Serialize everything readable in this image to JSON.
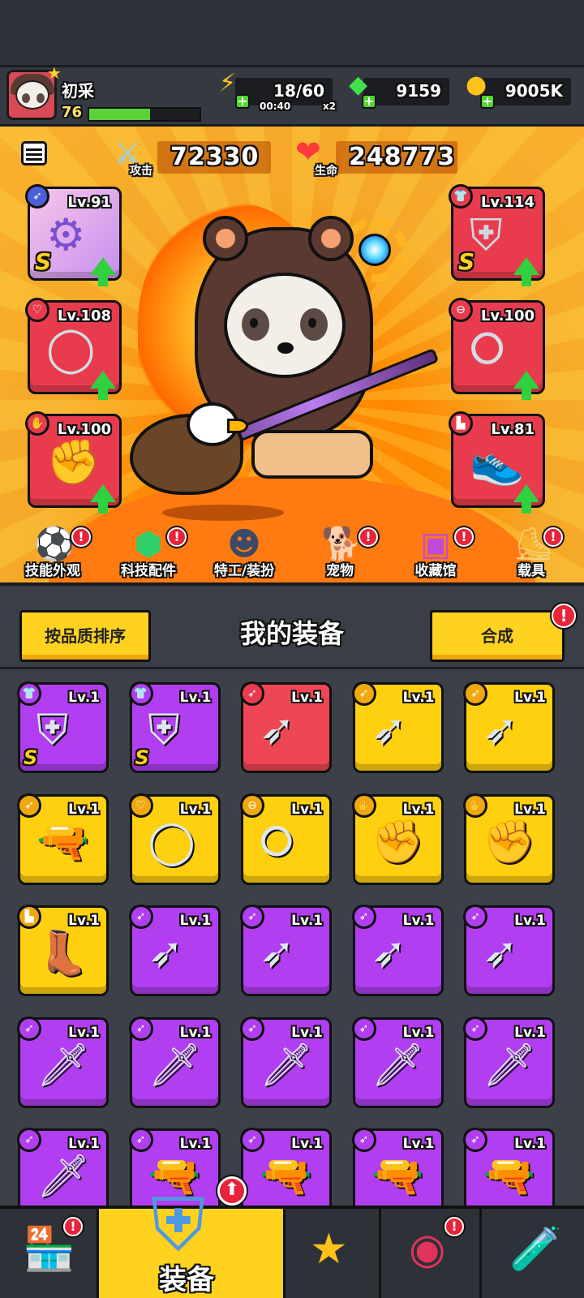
{
  "player": {
    "name": "初采",
    "level": "76",
    "xp_fraction": 0.55
  },
  "resources": {
    "energy": {
      "value": "18/60",
      "timer": "00:40",
      "multiplier": "x2",
      "icon": "energy-bolt-icon"
    },
    "gems": {
      "value": "9159",
      "icon": "green-gem-icon"
    },
    "coins": {
      "value": "9005K",
      "icon": "gold-coin-icon"
    }
  },
  "stats": {
    "attack": {
      "label": "攻击",
      "value": "72330"
    },
    "health": {
      "label": "生命",
      "value": "248773"
    }
  },
  "equipped": {
    "weapon": {
      "level": "Lv.91",
      "rarity": "S",
      "upgradable": true
    },
    "armor": {
      "level": "Lv.114",
      "rarity": "S",
      "upgradable": true
    },
    "necklace": {
      "level": "Lv.108",
      "upgradable": true
    },
    "belt": {
      "level": "Lv.100",
      "upgradable": true
    },
    "gloves": {
      "level": "Lv.100",
      "upgradable": true
    },
    "boots": {
      "level": "Lv.81",
      "upgradable": true
    }
  },
  "quick_nav": [
    {
      "label": "技能外观",
      "icon": "skill-skin-icon",
      "alert": "!"
    },
    {
      "label": "科技配件",
      "icon": "tech-part-icon",
      "alert": "!"
    },
    {
      "label": "特工/装扮",
      "icon": "agent-costume-icon",
      "alert": ""
    },
    {
      "label": "宠物",
      "icon": "pet-icon",
      "alert": "!"
    },
    {
      "label": "收藏馆",
      "icon": "collection-icon",
      "alert": "!"
    },
    {
      "label": "载具",
      "icon": "vehicle-icon",
      "alert": "!"
    }
  ],
  "inventory": {
    "sort_label": "按品质排序",
    "title": "我的装备",
    "merge_label": "合成",
    "merge_alert": "!",
    "items": [
      {
        "level": "Lv.1",
        "color": "purple",
        "kind": "armor",
        "s": "S"
      },
      {
        "level": "Lv.1",
        "color": "purple",
        "kind": "armor",
        "s": "S"
      },
      {
        "level": "Lv.1",
        "color": "red",
        "kind": "kunai",
        "s": ""
      },
      {
        "level": "Lv.1",
        "color": "yellow",
        "kind": "kunai",
        "s": ""
      },
      {
        "level": "Lv.1",
        "color": "yellow",
        "kind": "kunai",
        "s": ""
      },
      {
        "level": "Lv.1",
        "color": "yellow",
        "kind": "revolver",
        "s": ""
      },
      {
        "level": "Lv.1",
        "color": "yellow",
        "kind": "necklace",
        "s": ""
      },
      {
        "level": "Lv.1",
        "color": "yellow",
        "kind": "belt",
        "s": ""
      },
      {
        "level": "Lv.1",
        "color": "yellow",
        "kind": "gloves",
        "s": ""
      },
      {
        "level": "Lv.1",
        "color": "yellow",
        "kind": "gloves",
        "s": ""
      },
      {
        "level": "Lv.1",
        "color": "yellow",
        "kind": "boots",
        "s": ""
      },
      {
        "level": "Lv.1",
        "color": "purple",
        "kind": "kunai",
        "s": ""
      },
      {
        "level": "Lv.1",
        "color": "purple",
        "kind": "kunai",
        "s": ""
      },
      {
        "level": "Lv.1",
        "color": "purple",
        "kind": "kunai",
        "s": ""
      },
      {
        "level": "Lv.1",
        "color": "purple",
        "kind": "kunai",
        "s": ""
      },
      {
        "level": "Lv.1",
        "color": "purple",
        "kind": "katana",
        "s": ""
      },
      {
        "level": "Lv.1",
        "color": "purple",
        "kind": "katana",
        "s": ""
      },
      {
        "level": "Lv.1",
        "color": "purple",
        "kind": "katana",
        "s": ""
      },
      {
        "level": "Lv.1",
        "color": "purple",
        "kind": "katana",
        "s": ""
      },
      {
        "level": "Lv.1",
        "color": "purple",
        "kind": "katana",
        "s": ""
      },
      {
        "level": "Lv.1",
        "color": "purple",
        "kind": "katana",
        "s": ""
      },
      {
        "level": "Lv.1",
        "color": "purple",
        "kind": "revolver",
        "s": ""
      },
      {
        "level": "Lv.1",
        "color": "purple",
        "kind": "revolver",
        "s": ""
      },
      {
        "level": "Lv.1",
        "color": "purple",
        "kind": "revolver",
        "s": ""
      },
      {
        "level": "Lv.1",
        "color": "purple",
        "kind": "revolver",
        "s": ""
      }
    ]
  },
  "bottom_nav": [
    {
      "label": "",
      "icon": "shop-icon",
      "alert": "!"
    },
    {
      "label": "装备",
      "icon": "equipment-icon",
      "alert": "",
      "active": true
    },
    {
      "label": "",
      "icon": "battle-star-icon",
      "alert": ""
    },
    {
      "label": "",
      "icon": "star-ball-icon",
      "alert": "!"
    },
    {
      "label": "",
      "icon": "dna-tube-icon",
      "alert": ""
    }
  ],
  "colors": {
    "accent_yellow": "#ffd21f",
    "alert_red": "#e8243a",
    "rarity_purple": "#b13ef0",
    "rarity_yellow": "#ffd00f",
    "rarity_red": "#ef4656",
    "upgrade_green": "#2fd13f"
  }
}
